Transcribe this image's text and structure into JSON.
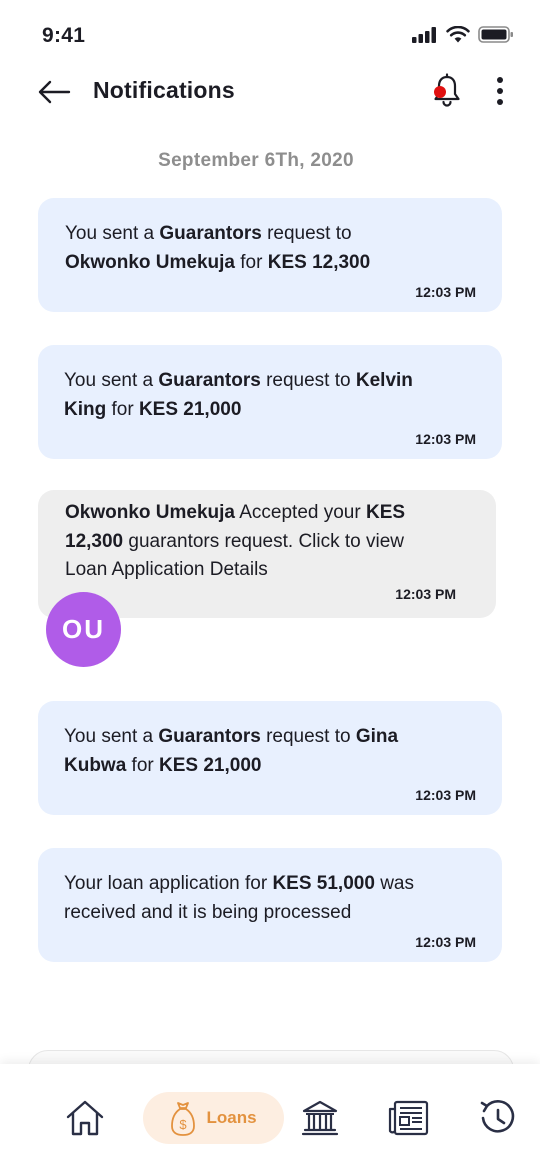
{
  "status_bar": {
    "time": "9:41"
  },
  "header": {
    "title": "Notifications"
  },
  "date_label": "September 6Th, 2020",
  "notifications": [
    {
      "parts": [
        {
          "t": "You sent a ",
          "b": false
        },
        {
          "t": "Guarantors",
          "b": true
        },
        {
          "t": " request to",
          "b": false
        },
        {
          "t": "\n",
          "b": false
        },
        {
          "t": "Okwonko Umekuja",
          "b": true
        },
        {
          "t": " for ",
          "b": false
        },
        {
          "t": "KES 12,300",
          "b": true
        }
      ],
      "time": "12:03 PM"
    },
    {
      "parts": [
        {
          "t": "You sent a ",
          "b": false
        },
        {
          "t": "Guarantors",
          "b": true
        },
        {
          "t": " request to ",
          "b": false
        },
        {
          "t": "Kelvin",
          "b": true
        },
        {
          "t": "\n",
          "b": false
        },
        {
          "t": "King",
          "b": true
        },
        {
          "t": " for ",
          "b": false
        },
        {
          "t": "KES 21,000",
          "b": true
        }
      ],
      "time": "12:03 PM"
    },
    {
      "parts": [
        {
          "t": "Okwonko Umekuja",
          "b": true
        },
        {
          "t": " Accepted your ",
          "b": false
        },
        {
          "t": "KES",
          "b": true
        },
        {
          "t": "\n",
          "b": false
        },
        {
          "t": "12,300",
          "b": true
        },
        {
          "t": " guarantors request. Click to view",
          "b": false
        },
        {
          "t": "\n",
          "b": false
        },
        {
          "t": "Loan Application Details",
          "b": false
        }
      ],
      "time": "12:03 PM",
      "avatar_initials": "OU"
    },
    {
      "parts": [
        {
          "t": "You sent a ",
          "b": false
        },
        {
          "t": "Guarantors",
          "b": true
        },
        {
          "t": " request to ",
          "b": false
        },
        {
          "t": "Gina",
          "b": true
        },
        {
          "t": "\n",
          "b": false
        },
        {
          "t": "Kubwa",
          "b": true
        },
        {
          "t": " for ",
          "b": false
        },
        {
          "t": "KES 21,000",
          "b": true
        }
      ],
      "time": "12:03 PM"
    },
    {
      "parts": [
        {
          "t": "Your loan application for ",
          "b": false
        },
        {
          "t": "KES 51,000",
          "b": true
        },
        {
          "t": " was",
          "b": false
        },
        {
          "t": "\n",
          "b": false
        },
        {
          "t": "received and it is being processed",
          "b": false
        }
      ],
      "time": "12:03 PM"
    }
  ],
  "bottom_nav": {
    "items": [
      {
        "icon": "home-icon"
      },
      {
        "icon": "money-bag-icon",
        "label": "Loans",
        "active": true
      },
      {
        "icon": "bank-icon"
      },
      {
        "icon": "newspaper-icon"
      },
      {
        "icon": "history-icon"
      }
    ]
  },
  "colors": {
    "accent": "#e3923f",
    "accent_bg": "#fdeee1",
    "card_blue": "#e8f0fe",
    "card_grey": "#eeeeee",
    "avatar": "#b05ce8",
    "badge": "#e01010"
  }
}
